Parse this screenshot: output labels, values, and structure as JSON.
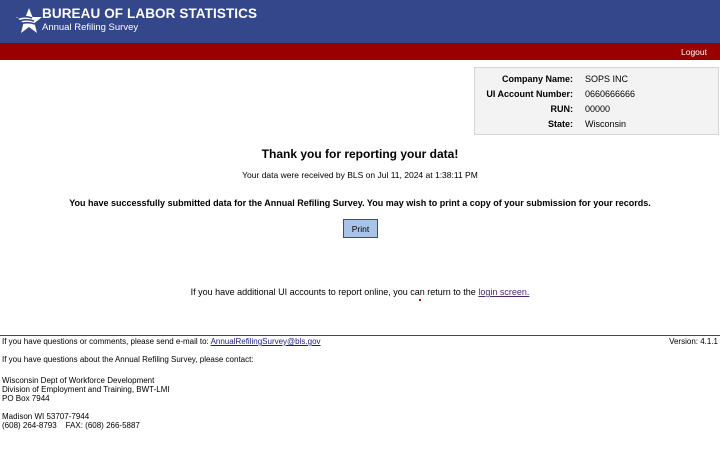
{
  "header": {
    "title": "BUREAU OF LABOR STATISTICS",
    "subtitle": "Annual Refiling Survey",
    "logout_label": "Logout",
    "colors": {
      "header_bg": "#33478a",
      "bar_bg": "#990000"
    }
  },
  "account_info": {
    "company_label": "Company Name:",
    "company_value": "SOPS INC",
    "ui_label": "UI Account Number:",
    "ui_value": "0660666666",
    "run_label": "RUN:",
    "run_value": "00000",
    "state_label": "State:",
    "state_value": "Wisconsin"
  },
  "main": {
    "thank_you": "Thank you for reporting your data!",
    "received": "Your data were received by BLS on Jul 11, 2024 at  1:38:11 PM",
    "success": "You have successfully submitted data for the Annual Refiling Survey. You may wish to print a copy of your submission for your records.",
    "print_label": "Print",
    "additional_text": "If you have additional UI accounts to report online, you can return to the",
    "login_link": "login screen."
  },
  "footer": {
    "questions_text": "If you have questions or comments, please send e-mail to:",
    "email": "AnnualRefilingSurvey@bls.gov",
    "version": "Version: 4.1.1",
    "contact_intro": "If you have questions about the Annual Refiling Survey, please contact:",
    "address_line1": "Wisconsin Dept of Workforce Development",
    "address_line2": "Division of Employment and Training, BWT-LMI",
    "address_line3": "PO Box 7944",
    "address_line4": "Madison WI 53707-7944",
    "phone": "(608) 264-8793",
    "fax": "FAX: (608) 266-5887"
  }
}
